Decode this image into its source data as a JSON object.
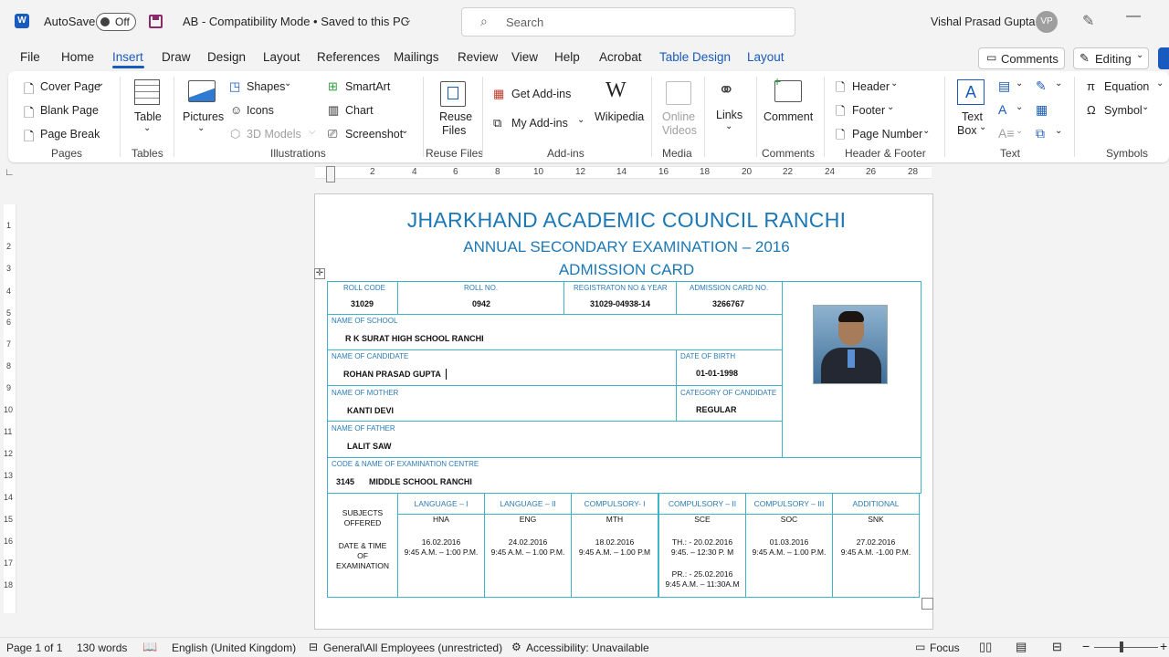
{
  "titlebar": {
    "autosave_label": "AutoSave",
    "autosave_state": "Off",
    "doc_title": "AB  -  Compatibility Mode • Saved to this PC",
    "search_placeholder": "Search",
    "user_name": "Vishal Prasad Gupta",
    "user_initials": "VP"
  },
  "tabs": [
    "File",
    "Home",
    "Insert",
    "Draw",
    "Design",
    "Layout",
    "References",
    "Mailings",
    "Review",
    "View",
    "Help",
    "Acrobat",
    "Table Design",
    "Layout"
  ],
  "right_buttons": {
    "comments": "Comments",
    "editing": "Editing"
  },
  "ribbon": {
    "pages": {
      "cover_page": "Cover Page",
      "blank_page": "Blank Page",
      "page_break": "Page Break",
      "group": "Pages"
    },
    "tables": {
      "table": "Table",
      "group": "Tables"
    },
    "illustrations": {
      "pictures": "Pictures",
      "shapes": "Shapes",
      "icons": "Icons",
      "models": "3D Models",
      "smartart": "SmartArt",
      "chart": "Chart",
      "screenshot": "Screenshot",
      "group": "Illustrations"
    },
    "reuse": {
      "reuse_l1": "Reuse",
      "reuse_l2": "Files",
      "group": "Reuse Files"
    },
    "addins": {
      "get": "Get Add-ins",
      "my": "My Add-ins",
      "wikipedia": "Wikipedia",
      "group": "Add-ins"
    },
    "media": {
      "online_l1": "Online",
      "online_l2": "Videos",
      "group": "Media"
    },
    "links": {
      "links": "Links"
    },
    "comments": {
      "comment": "Comment",
      "group": "Comments"
    },
    "header_footer": {
      "header": "Header",
      "footer": "Footer",
      "page_number": "Page Number",
      "group": "Header & Footer"
    },
    "text": {
      "textbox_l1": "Text",
      "textbox_l2": "Box",
      "group": "Text"
    },
    "symbols": {
      "equation": "Equation",
      "symbol": "Symbol",
      "group": "Symbols"
    }
  },
  "ruler": [
    "2",
    "4",
    "6",
    "8",
    "10",
    "12",
    "14",
    "16",
    "18",
    "20",
    "22",
    "24",
    "26",
    "28"
  ],
  "vruler": [
    "1",
    "2",
    "3",
    "4",
    "5",
    "6",
    "7",
    "8",
    "9",
    "10",
    "11",
    "12",
    "13",
    "14",
    "15",
    "16",
    "17",
    "18"
  ],
  "card": {
    "title": "JHARKHAND ACADEMIC COUNCIL RANCHI",
    "subtitle": "ANNUAL SECONDARY EXAMINATION – 2016",
    "subtitle2": "ADMISSION CARD",
    "roll_code_label": "ROLL CODE",
    "roll_code": "31029",
    "roll_no_label": "ROLL NO.",
    "roll_no": "0942",
    "reg_label": "REGISTRATON NO & YEAR",
    "reg": "31029-04938-14",
    "adm_label": "ADMISSION CARD NO.",
    "adm": "3266767",
    "school_label": "NAME OF SCHOOL",
    "school": "R K SURAT HIGH SCHOOL RANCHI",
    "candidate_label": "NAME OF CANDIDATE",
    "candidate": "ROHAN PRASAD GUPTA",
    "dob_label": "DATE OF BIRTH",
    "dob": "01-01-1998",
    "mother_label": "NAME OF MOTHER",
    "mother": "KANTI DEVI",
    "category_label": "CATEGORY OF CANDIDATE",
    "category": "REGULAR",
    "father_label": "NAME OF FATHER",
    "father": "LALIT SAW",
    "centre_label": "CODE & NAME OF EXAMINATION CENTRE",
    "centre_code": "3145",
    "centre_name": "MIDDLE SCHOOL RANCHI",
    "subjects_l1": "SUBJECTS",
    "subjects_l2": "OFFERED",
    "dt_l1": "DATE & TIME",
    "dt_l2": "OF",
    "dt_l3": "EXAMINATION",
    "subjects": [
      {
        "head": "LANGUAGE – I",
        "code": "HNA",
        "date": "16.02.2016",
        "time": "9:45 A.M. – 1:00 P.M."
      },
      {
        "head": "LANGUAGE – II",
        "code": "ENG",
        "date": "24.02.2016",
        "time": "9:45 A.M. – 1.00 P.M."
      },
      {
        "head": "COMPULSORY- I",
        "code": "MTH",
        "date": "18.02.2016",
        "time": "9:45 A.M. – 1.00 P.M"
      },
      {
        "head": "COMPULSORY – II",
        "code": "SCE",
        "date": "TH.: - 20.02.2016",
        "time": "9:45. – 12:30 P. M",
        "extra1": "PR.: - 25.02.2016",
        "extra2": "9:45 A.M. – 11:30A.M"
      },
      {
        "head": "COMPULSORY – III",
        "code": "SOC",
        "date": "01.03.2016",
        "time": "9:45 A.M. – 1.00 P.M."
      },
      {
        "head": "ADDITIONAL",
        "code": "SNK",
        "date": "27.02.2016",
        "time": "9:45 A.M. -1.00 P.M."
      }
    ]
  },
  "status": {
    "page": "Page 1 of 1",
    "words": "130 words",
    "language": "English (United Kingdom)",
    "sensitivity": "General\\All Employees (unrestricted)",
    "accessibility": "Accessibility: Unavailable",
    "focus": "Focus"
  },
  "colors": {
    "accent": "#185abd",
    "card_blue": "#1b78b5",
    "cell_border": "#3fb4c9"
  }
}
